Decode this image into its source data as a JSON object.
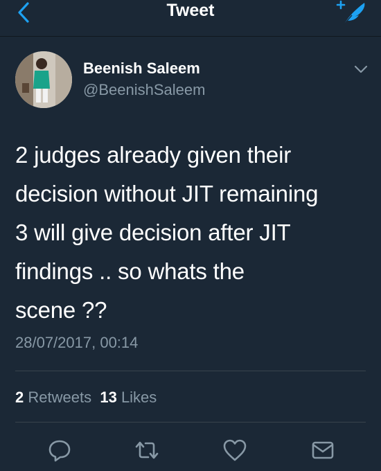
{
  "nav": {
    "title": "Tweet",
    "back_icon": "chevron-left-icon",
    "compose_icon": "compose-feather-icon"
  },
  "tweet": {
    "author_name": "Beenish Saleem",
    "author_handle": "@BeenishSaleem",
    "text_lines": [
      "2 judges already given their",
      "decision without JIT remaining",
      "3 will give decision after JIT",
      "findings .. so whats the",
      "scene ??"
    ],
    "timestamp": "28/07/2017, 00:14"
  },
  "stats": {
    "retweets_count": "2",
    "retweets_label": "Retweets",
    "likes_count": "13",
    "likes_label": "Likes"
  },
  "actions": [
    {
      "icon": "reply-icon"
    },
    {
      "icon": "retweet-icon"
    },
    {
      "icon": "like-heart-icon"
    },
    {
      "icon": "message-envelope-icon"
    }
  ],
  "colors": {
    "background": "#1b2836",
    "accent": "#1da1f2",
    "secondary_text": "#8899a6",
    "divider": "#38444d"
  }
}
